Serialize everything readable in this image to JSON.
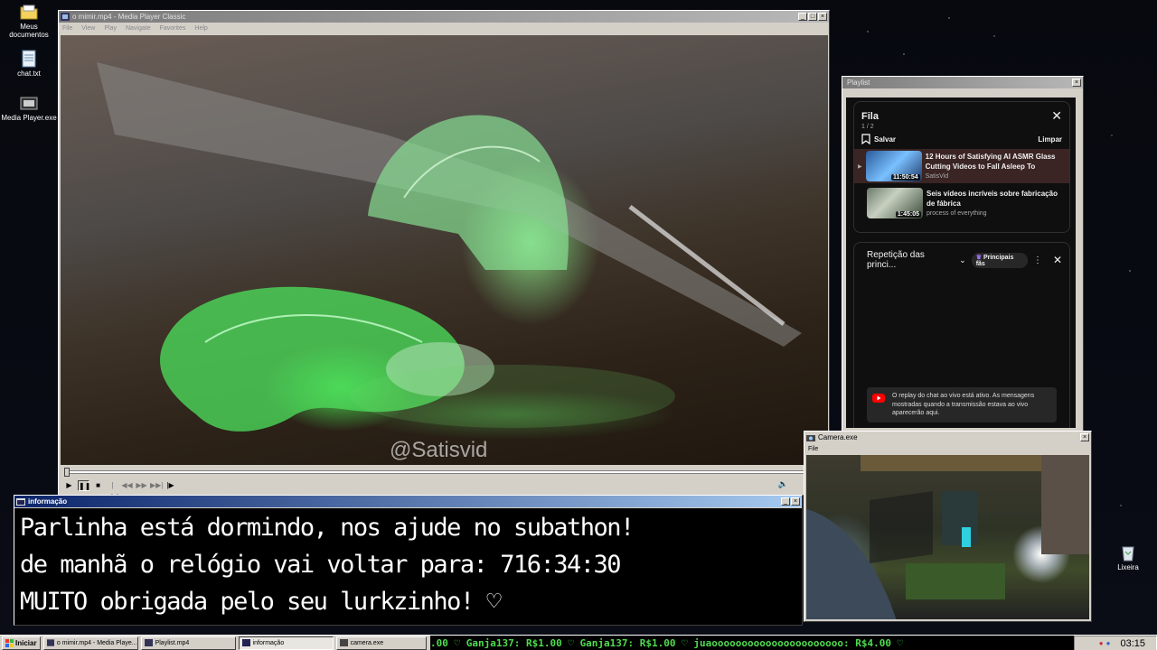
{
  "desktop": {
    "icons": [
      {
        "label": "Meus documentos"
      },
      {
        "label": "chat.txt"
      },
      {
        "label": "Media Player.exe"
      },
      {
        "label": "Lixeira"
      }
    ]
  },
  "player": {
    "title": "o mimir.mp4 - Media Player Classic",
    "menu": [
      "File",
      "View",
      "Play",
      "Navigate",
      "Favorites",
      "Help"
    ],
    "watermark": "@Satisvid",
    "progress": 0.0
  },
  "playlist_window": {
    "title": "Playlist",
    "queue_title": "Fila",
    "queue_count": "1 / 2",
    "save_label": "Salvar",
    "clear_label": "Limpar",
    "items": [
      {
        "title": "12 Hours of Satisfying AI ASMR Glass Cutting Videos to Fall Asleep To",
        "channel": "SatisVid",
        "duration": "11:50:54",
        "playing": true
      },
      {
        "title": "Seis vídeos incríveis sobre fabricação de fábrica",
        "channel": "process of everything",
        "duration": "1:45:05",
        "playing": false
      }
    ],
    "chat_header": "Repetição das princi...",
    "chat_filter_chip": "Principais fãs",
    "chat_notice": "O replay do chat ao vivo está ativo. As mensagens mostradas quando a transmissão estava ao vivo aparecerão aqui."
  },
  "info_window": {
    "title": "informação",
    "lines": [
      "Parlinha está dormindo, nos ajude no subathon!",
      "de manhã o relógio vai voltar para:  716:34:30",
      "MUITO obrigada pelo seu lurkzinho! ♡"
    ]
  },
  "camera_window": {
    "title": "Camera.exe",
    "menu": "File"
  },
  "taskbar": {
    "start_label": "Iniciar",
    "tasks": [
      {
        "label": "o mimir.mp4 - Media Playe...",
        "active": false
      },
      {
        "label": "Playlist.mp4",
        "active": false
      },
      {
        "label": "informação",
        "active": true
      },
      {
        "label": "camera.exe",
        "active": false
      }
    ],
    "ticker": ".00  ♡ Ganja137: R$1.00  ♡ Ganja137: R$1.00  ♡ juaoooooooooooooooooooooo: R$4.00  ♡",
    "clock": "03:15"
  },
  "colors": {
    "title_active": "#0a246a",
    "ticker_green": "#4fdc4f",
    "yt_bg": "#0f0f0f"
  }
}
